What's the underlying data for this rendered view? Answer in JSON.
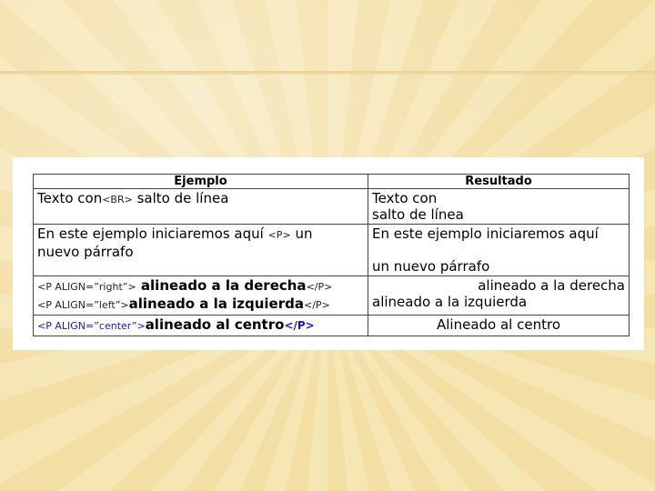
{
  "table": {
    "headers": [
      "Ejemplo",
      "Resultado"
    ],
    "row1": {
      "ex_pre": "Texto con",
      "ex_tag": "<BR>",
      "ex_post": " salto de línea",
      "res_line1": "Texto con",
      "res_line2": "salto de línea"
    },
    "row2": {
      "ex_pre": "En este ejemplo iniciaremos aquí ",
      "ex_tag": "<P>",
      "ex_post": " un",
      "ex_line2": "nuevo párrafo",
      "res_line1": "En este ejemplo iniciaremos aquí",
      "res_line2": "un nuevo párrafo"
    },
    "row3": {
      "l1_open": "<P ALIGN=”right”>",
      "l1_text": " alineado a la derecha",
      "l1_close": "</P>",
      "l2_open": "<P ALIGN=”left”>",
      "l2_text": "alineado a la izquierda",
      "l2_close": "</P>",
      "res_right": "alineado a la derecha",
      "res_left": "alineado a la izquierda"
    },
    "row4": {
      "open": "<P ALIGN=”center”>",
      "text": "alineado al centro",
      "close": "</P>",
      "res": "Alineado al centro"
    }
  }
}
